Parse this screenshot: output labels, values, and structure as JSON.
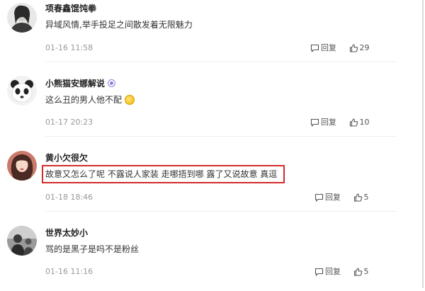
{
  "comments": [
    {
      "username": "项春鑫馄饨拳",
      "text": "异域风情,举手投足之间散发着无限魅力",
      "timestamp": "01-16 11:58",
      "reply_label": "回复",
      "likes": "29"
    },
    {
      "username": "小熊猫安娜解说",
      "verified": true,
      "text": "这么丑的男人他不配",
      "emoji": "smile-emoji",
      "timestamp": "01-17 20:23",
      "reply_label": "回复",
      "likes": "10"
    },
    {
      "username": "黄小欠很欠",
      "text": "故意又怎么了呢 不露说人家装 走哪捂到哪 露了又说故意 真逗",
      "timestamp": "01-18 18:46",
      "reply_label": "回复",
      "likes": "5",
      "highlighted": true
    },
    {
      "username": "世界太妙小",
      "text": "骂的是黑子是吗不是粉丝",
      "timestamp": "01-16 11:16",
      "reply_label": "回复",
      "likes": "5"
    }
  ],
  "icons": {
    "reply": "comment-bubble-icon",
    "like": "thumbs-up-icon"
  },
  "colors": {
    "highlight_border": "#d42b2b",
    "verified_badge": "#8a7fd8",
    "timestamp": "#999999"
  }
}
